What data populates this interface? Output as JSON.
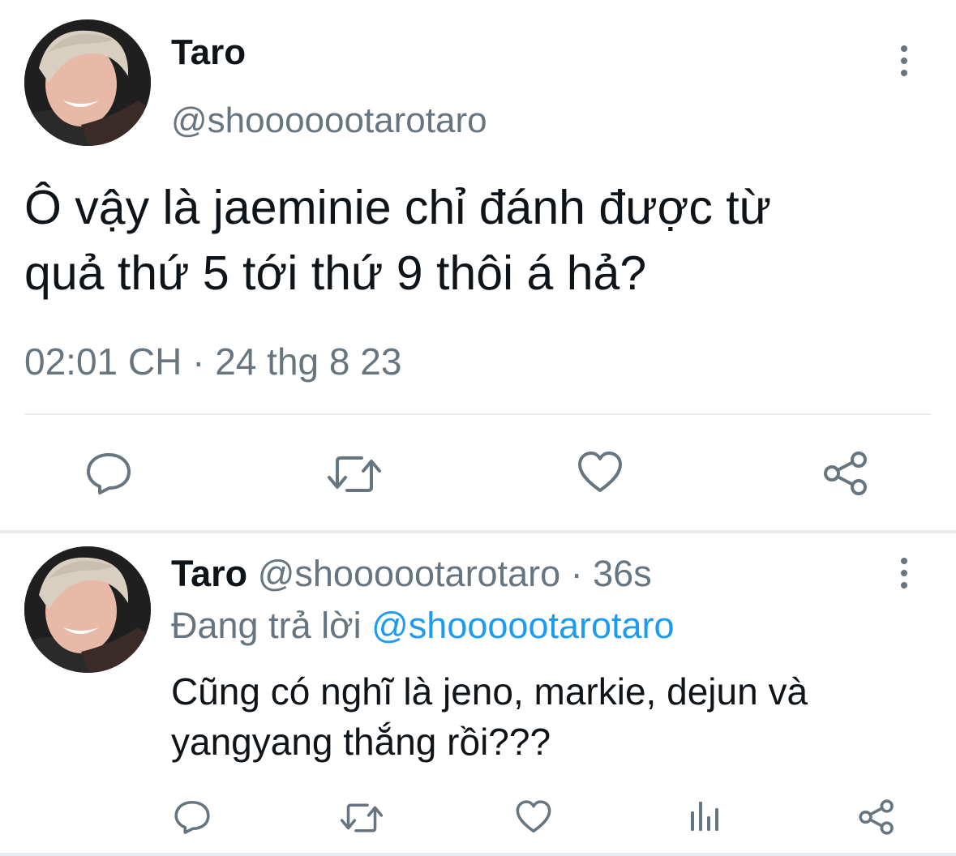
{
  "main_tweet": {
    "display_name": "Taro",
    "handle": "@shooooootarotaro",
    "text_line1": "Ô vậy là jaeminie chỉ đánh được từ",
    "text_line2": "quả thứ 5 tới thứ 9 thôi á hả?",
    "timestamp": "02:01 CH · 24 thg 8 23",
    "actions": [
      "reply-icon",
      "retweet-icon",
      "like-icon",
      "share-icon"
    ]
  },
  "reply_tweet": {
    "display_name": "Taro",
    "handle": "@shoooootarotaro",
    "time": "· 36s",
    "replying_prefix": "Đang trả lời",
    "replying_handle": "@shoooootarotaro",
    "text_line1": "Cũng có nghĩ là jeno, markie, dejun và",
    "text_line2": "yangyang thắng rồi???",
    "actions": [
      "reply-icon",
      "retweet-icon",
      "like-icon",
      "analytics-icon",
      "share-icon"
    ]
  },
  "colors": {
    "text": "#0f1419",
    "muted": "#66757f",
    "link": "#1d9bf0",
    "divider": "#e6ecf0"
  }
}
